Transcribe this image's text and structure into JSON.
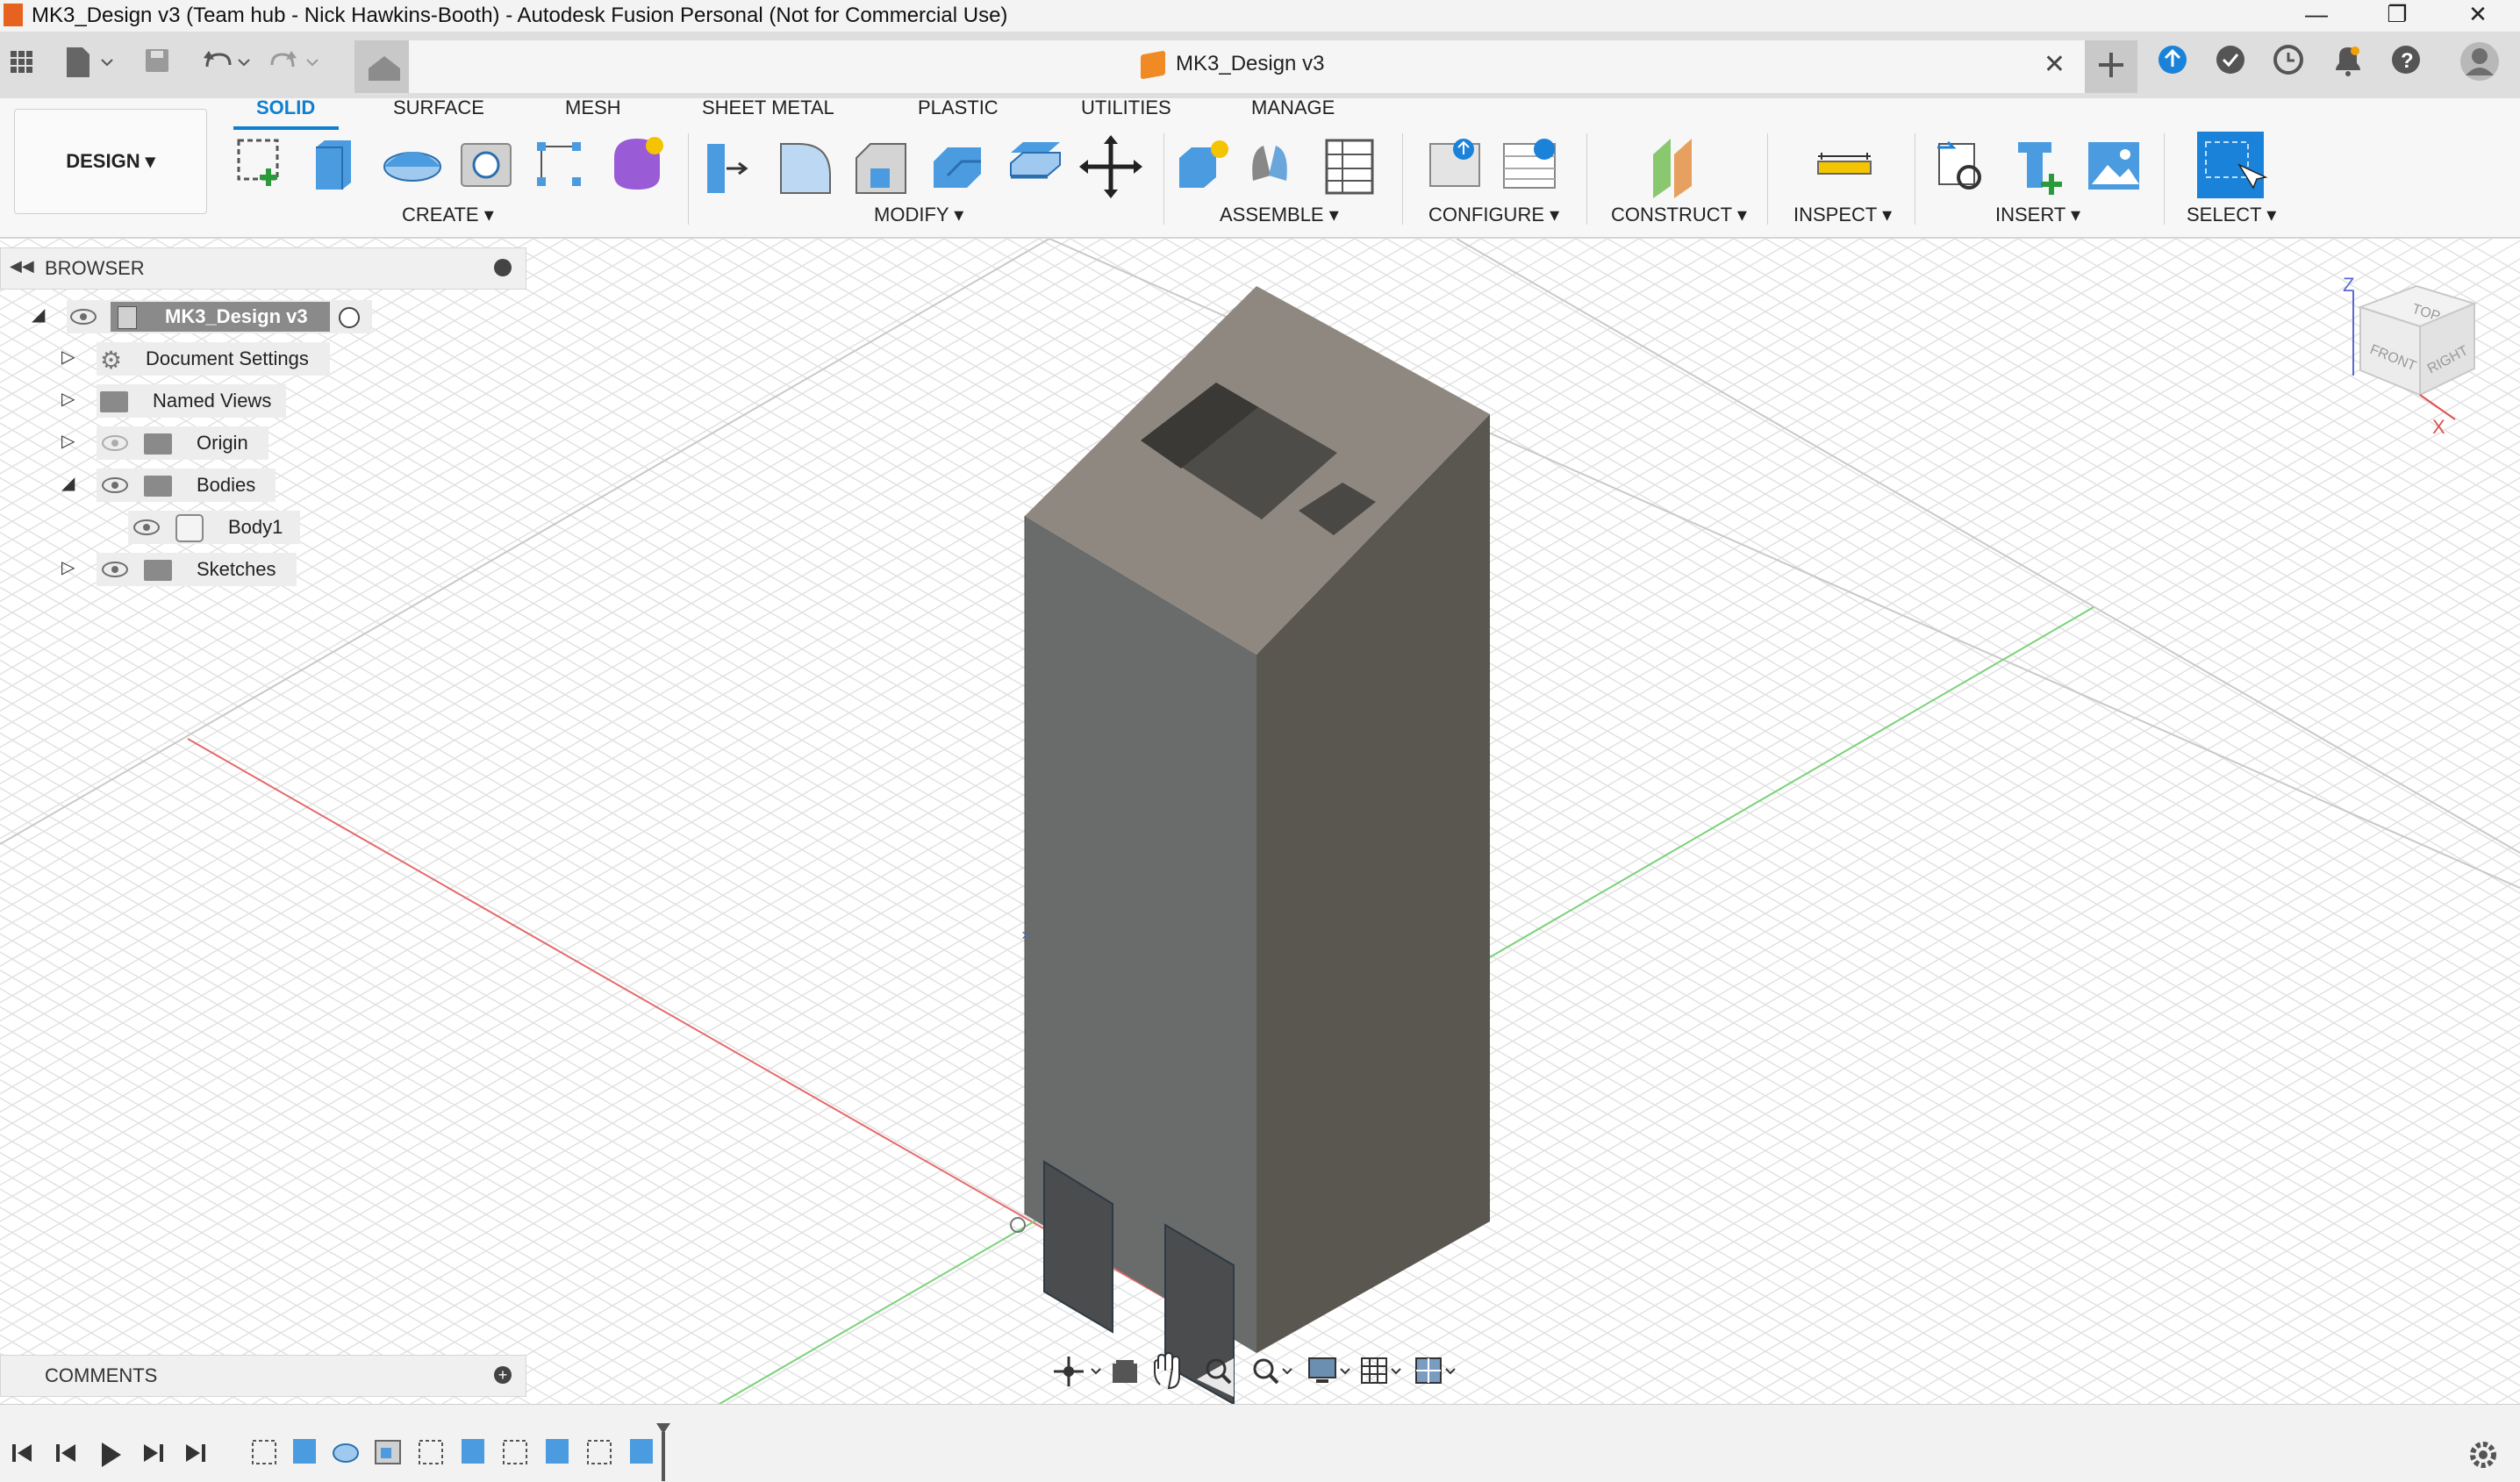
{
  "window": {
    "title": "MK3_Design v3 (Team hub - Nick Hawkins-Booth) - Autodesk Fusion Personal (Not for Commercial Use)",
    "controls": [
      "—",
      "❐",
      "✕"
    ]
  },
  "document_tab": {
    "name": "MK3_Design v3"
  },
  "workspace": {
    "label": "DESIGN ▾"
  },
  "ribbon": {
    "tabs": [
      "SOLID",
      "SURFACE",
      "MESH",
      "SHEET METAL",
      "PLASTIC",
      "UTILITIES",
      "MANAGE"
    ],
    "active_tab": "SOLID",
    "groups": [
      "CREATE ▾",
      "MODIFY ▾",
      "ASSEMBLE ▾",
      "CONFIGURE ▾",
      "CONSTRUCT ▾",
      "INSPECT ▾",
      "INSERT ▾",
      "SELECT ▾"
    ]
  },
  "browser": {
    "title": "BROWSER",
    "root": "MK3_Design v3",
    "items": [
      "Document Settings",
      "Named Views",
      "Origin",
      "Bodies",
      "Body1",
      "Sketches"
    ]
  },
  "comments": {
    "title": "COMMENTS"
  },
  "viewcube": {
    "top": "TOP",
    "front": "FRONT",
    "right": "RIGHT",
    "axis_z": "Z",
    "axis_x": "X"
  },
  "colors": {
    "accent": "#0f7fd1",
    "model_top": "#8e8880",
    "model_left": "#6a6c6c",
    "model_right": "#5a5650",
    "x_axis": "#e05050",
    "y_axis": "#5cc85c"
  },
  "icons": [
    "app-grid-icon",
    "file-icon",
    "save-icon",
    "undo-icon",
    "redo-icon",
    "home-icon",
    "new-tab-icon",
    "update-icon",
    "job-status-icon",
    "clock-icon",
    "bell-icon",
    "help-icon",
    "avatar-icon",
    "orbit-icon",
    "look-at-icon",
    "pan-icon",
    "zoom-icon",
    "fit-icon",
    "display-icon",
    "grid-icon",
    "viewports-icon",
    "settings-gear-icon"
  ]
}
